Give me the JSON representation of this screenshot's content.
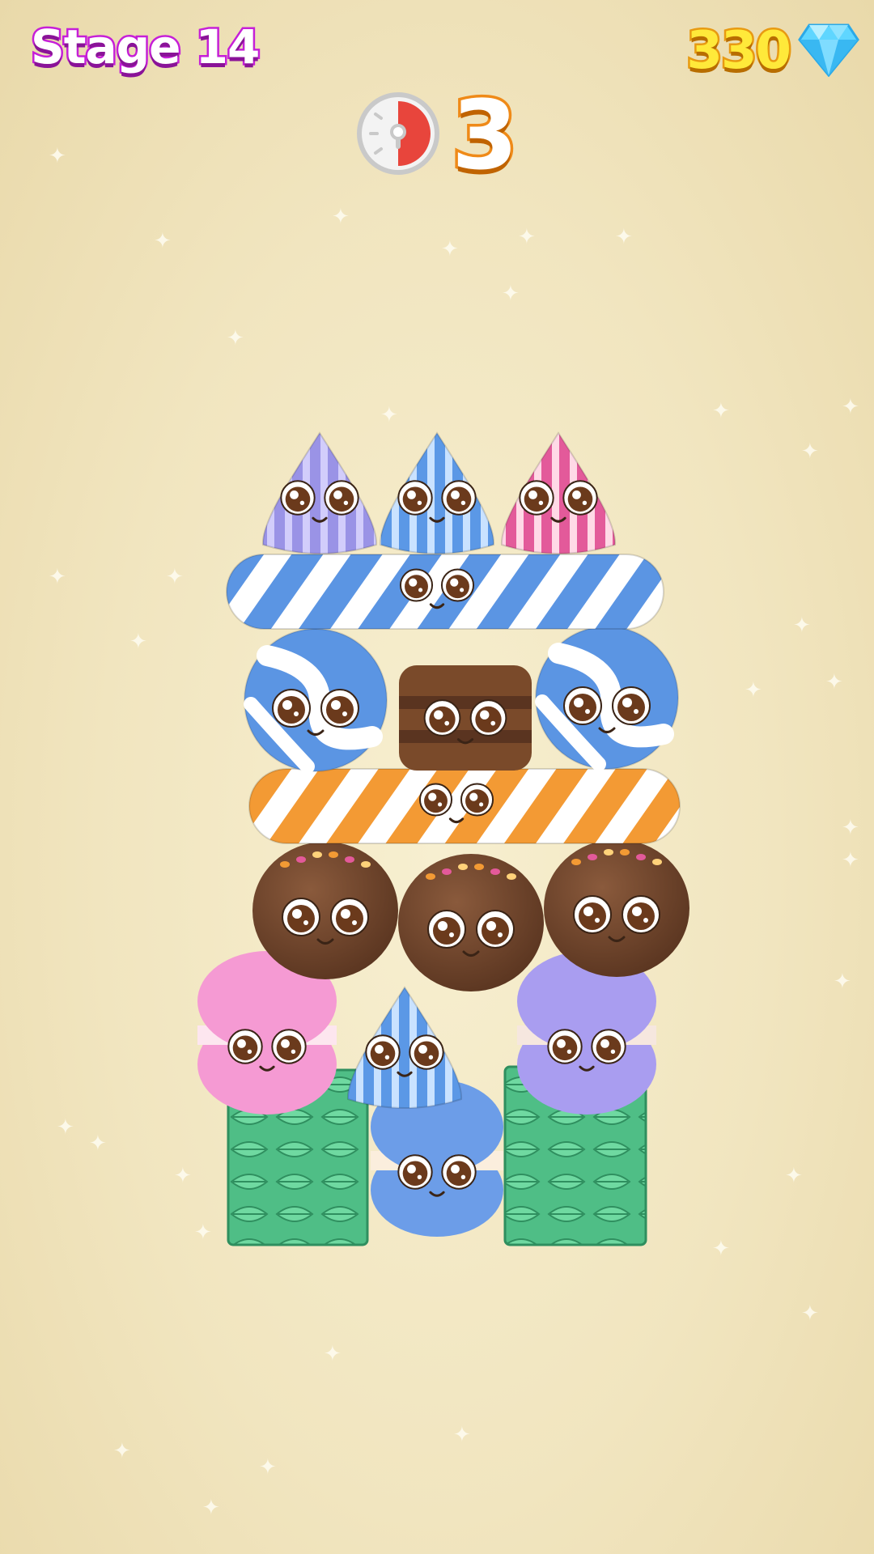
{
  "hud": {
    "stage_label": "Stage 14",
    "gem_count": "330",
    "gem_icon": "diamond-icon",
    "timer_icon": "stopwatch-icon",
    "timer_value": "3"
  },
  "colors": {
    "stage_outline": "#c61fd8",
    "gem_text": "#ffe93a",
    "gem_outline": "#e89a12",
    "timer_red": "#e8453c",
    "timer_outline": "#ef8a18",
    "background": "#f1e5bf"
  },
  "board": {
    "pieces": [
      "lavender-drop",
      "blue-drop",
      "pink-drop",
      "blue-striped-log",
      "blue-swirl-ball",
      "chocolate-macaron",
      "blue-swirl-ball",
      "orange-striped-log",
      "chocolate-ball",
      "chocolate-ball",
      "chocolate-ball",
      "pink-macaron",
      "blue-drop",
      "purple-macaron",
      "green-leaf-cube",
      "blue-macaron",
      "green-leaf-cube"
    ]
  }
}
